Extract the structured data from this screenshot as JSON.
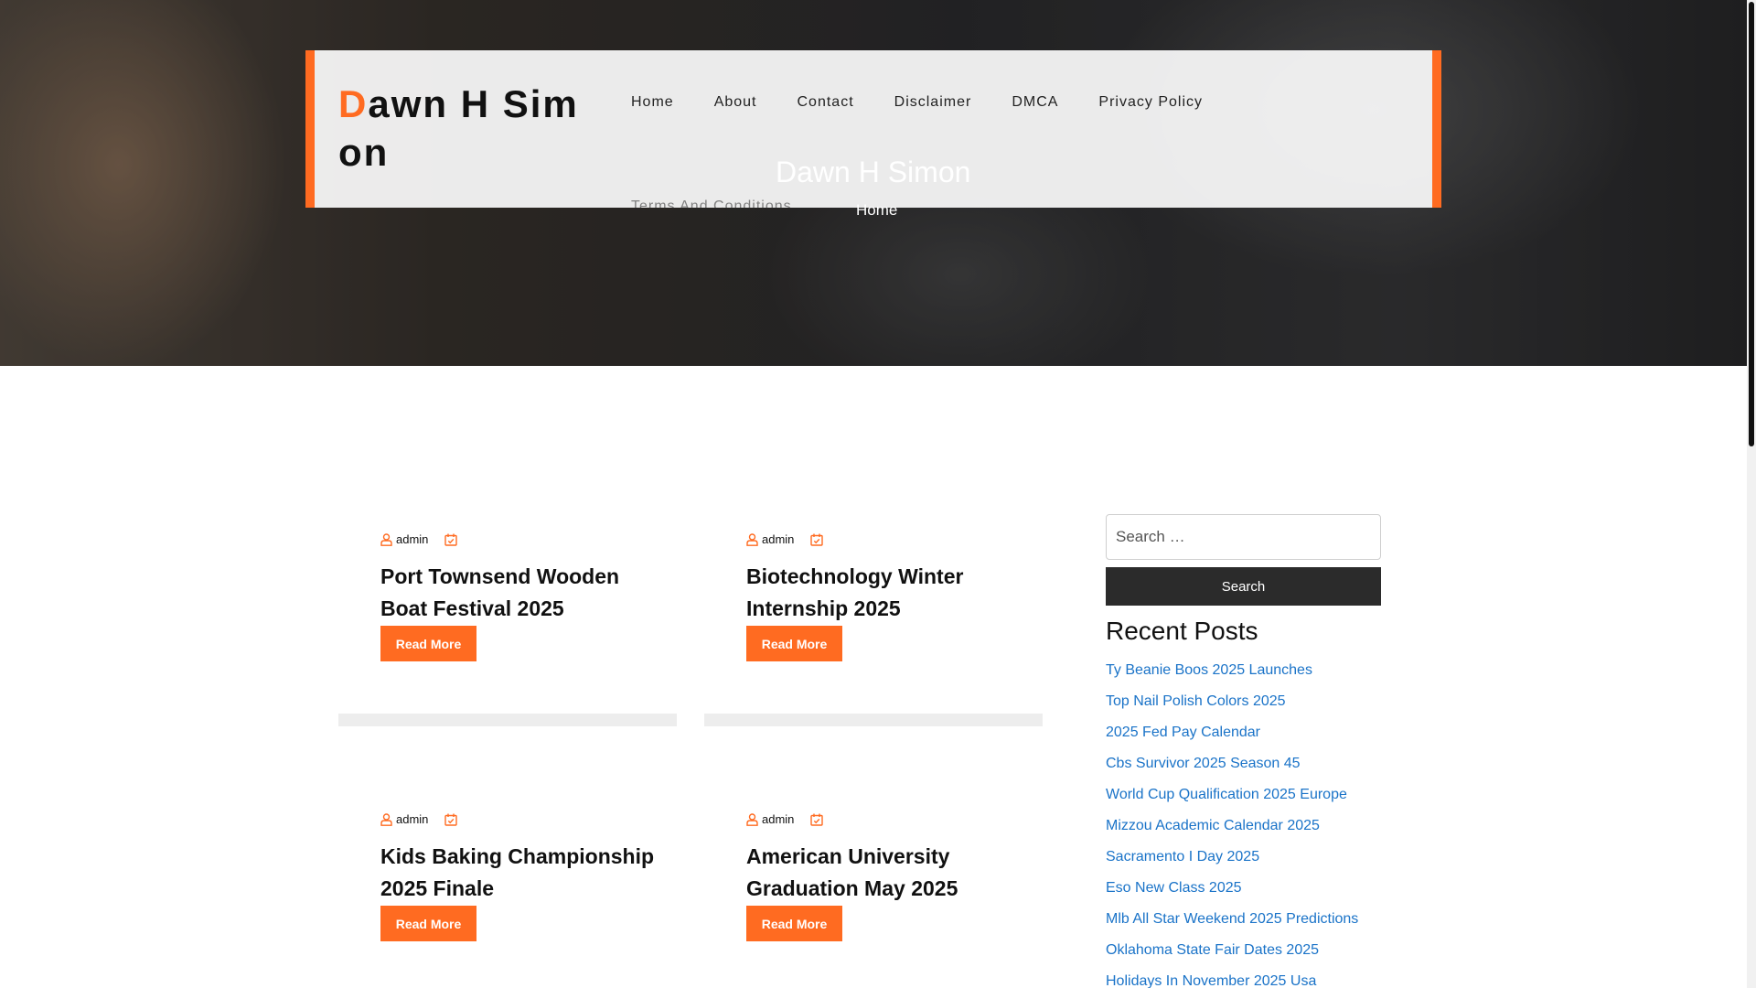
{
  "site": {
    "logo_first_letter": "D",
    "logo_rest": "awn H Simon",
    "hero_title": "Dawn H Simon",
    "breadcrumb": "Home"
  },
  "nav": {
    "items": [
      {
        "label": "Home"
      },
      {
        "label": "About"
      },
      {
        "label": "Contact"
      },
      {
        "label": "Disclaimer"
      },
      {
        "label": "DMCA"
      },
      {
        "label": "Privacy Policy"
      },
      {
        "label": "Terms And Conditions"
      }
    ]
  },
  "posts": [
    {
      "author": "admin",
      "title": "Port Townsend Wooden Boat Festival 2025",
      "button": "Read More"
    },
    {
      "author": "admin",
      "title": "Biotechnology Winter Internship 2025",
      "button": "Read More"
    },
    {
      "author": "admin",
      "title": "Kids Baking Championship 2025 Finale",
      "button": "Read More"
    },
    {
      "author": "admin",
      "title": "American University Graduation May 2025",
      "button": "Read More"
    }
  ],
  "sidebar": {
    "search_placeholder": "Search …",
    "search_button": "Search",
    "recent_heading": "Recent Posts",
    "recent_posts": [
      "Ty Beanie Boos 2025 Launches",
      "Top Nail Polish Colors 2025",
      "2025 Fed Pay Calendar",
      "Cbs Survivor 2025 Season 45",
      "World Cup Qualification 2025 Europe",
      "Mizzou Academic Calendar 2025",
      "Sacramento I Day 2025",
      "Eso New Class 2025",
      "Mlb All Star Weekend 2025 Predictions",
      "Oklahoma State Fair Dates 2025",
      "Holidays In November 2025 Usa"
    ]
  },
  "colors": {
    "accent": "#ff6b21",
    "link": "#1a73c8",
    "dark_button": "#2b2b2b"
  },
  "icons": {
    "author": "user-icon",
    "date": "calendar-check-icon"
  }
}
